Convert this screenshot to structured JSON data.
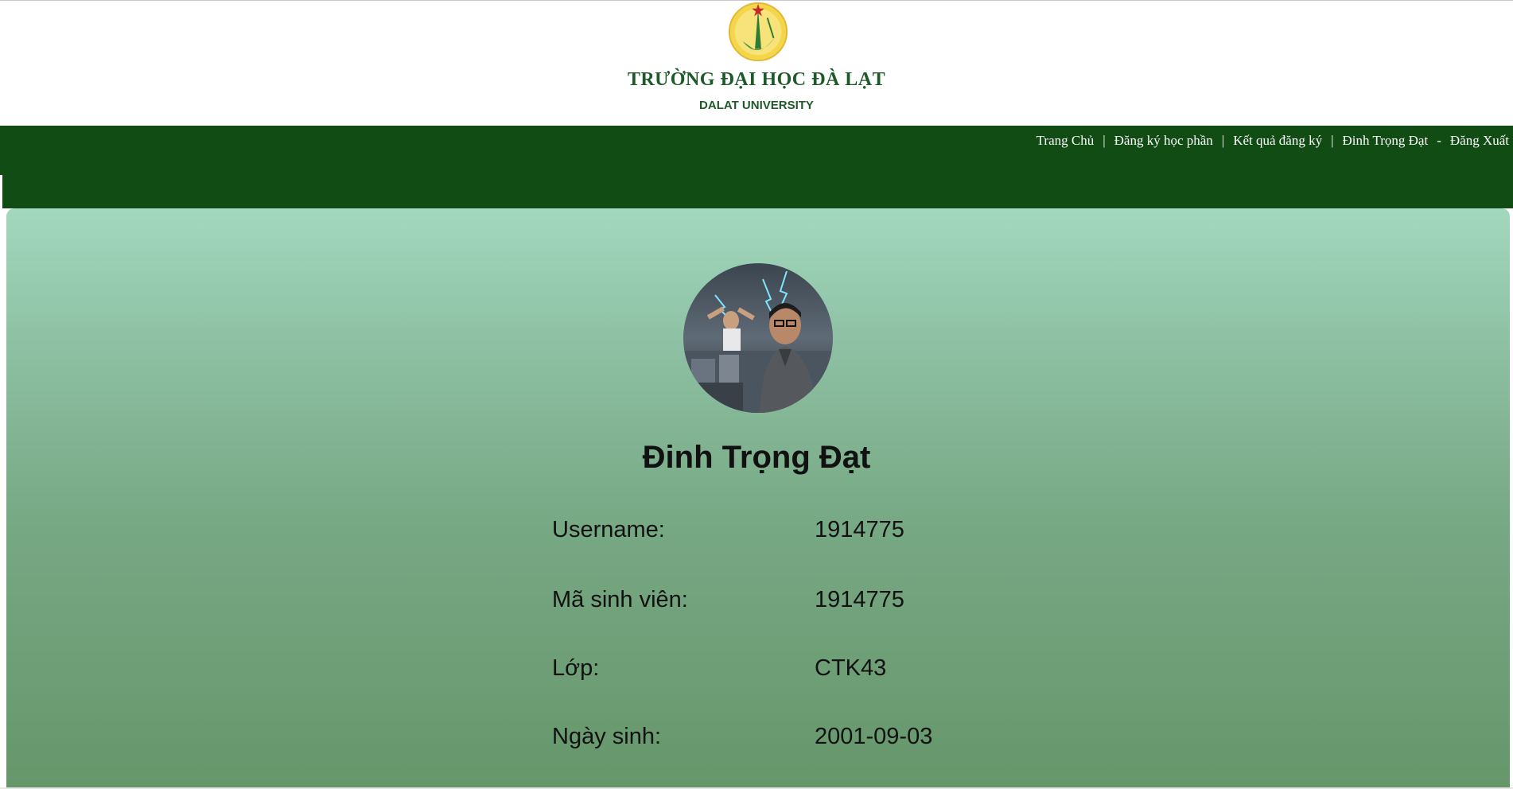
{
  "header": {
    "university_name": "TRƯỜNG ĐẠI HỌC ĐÀ LẠT",
    "university_name_en": "DALAT UNIVERSITY",
    "logo_icon": "university-seal-logo"
  },
  "nav": {
    "home": "Trang Chủ",
    "register_courses": "Đăng ký học phần",
    "registration_results": "Kết quả đăng ký",
    "user_name": "Đinh Trọng Đạt",
    "dash": "-",
    "logout": "Đăng Xuất",
    "separator": "|"
  },
  "profile": {
    "avatar_icon": "user-avatar-photo",
    "full_name": "Đinh Trọng Đạt",
    "fields": [
      {
        "label": "Username:",
        "value": "1914775"
      },
      {
        "label": "Mã sinh viên:",
        "value": "1914775"
      },
      {
        "label": "Lớp:",
        "value": "CTK43"
      },
      {
        "label": "Ngày sinh:",
        "value": "2001-09-03"
      }
    ]
  },
  "colors": {
    "nav_bg": "#114c14",
    "brand_green": "#1d5a2a",
    "card_top": "#a3d8bf",
    "card_bottom": "#66966a"
  }
}
